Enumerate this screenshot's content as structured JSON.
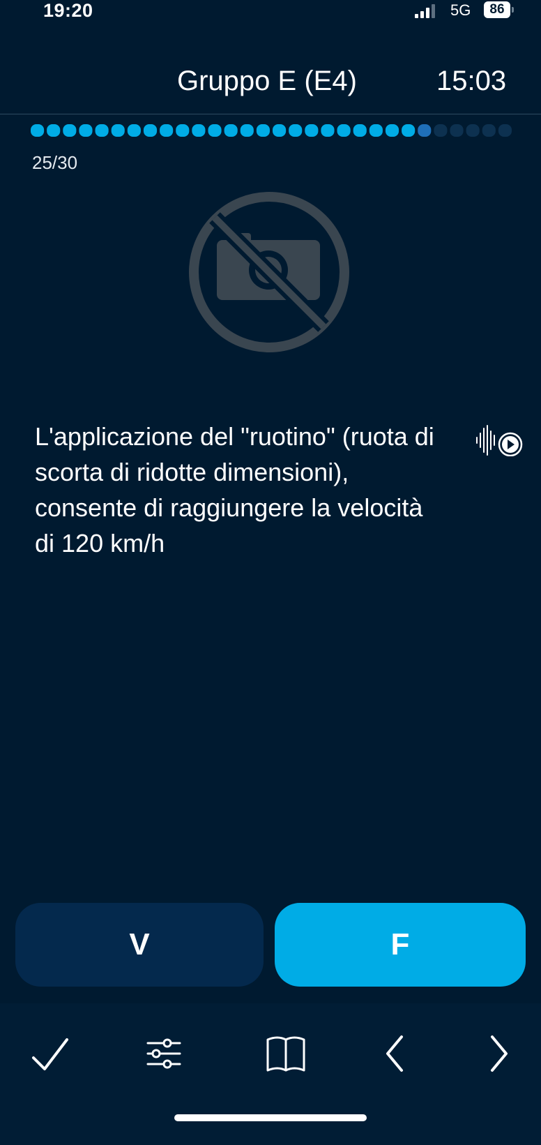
{
  "status_bar": {
    "time": "19:20",
    "network": "5G",
    "battery": "86"
  },
  "header": {
    "title": "Gruppo E (E4)",
    "timer": "15:03"
  },
  "progress": {
    "current": 25,
    "total": 30,
    "counter_text": "25/30",
    "colors": {
      "answered": "#00ace6",
      "current": "#1f6fb8",
      "remaining": "#0d3150"
    }
  },
  "image": {
    "icon": "no-photo-icon"
  },
  "question": {
    "text": "L'applicazione del \"ruotino\" (ruota di scorta di ridotte dimensioni), consente di raggiungere la velocità di 120 km/h"
  },
  "audio": {
    "icon": "audio-play-icon"
  },
  "answers": {
    "true_label": "V",
    "false_label": "F",
    "selected": "F"
  },
  "toolbar": {
    "items": [
      {
        "icon": "checkmark-icon"
      },
      {
        "icon": "settings-sliders-icon"
      },
      {
        "icon": "book-icon"
      },
      {
        "icon": "chevron-left-icon"
      },
      {
        "icon": "chevron-right-icon"
      }
    ]
  },
  "colors": {
    "background": "#001a30",
    "accent": "#00ace6",
    "button_dark": "#04294d"
  }
}
